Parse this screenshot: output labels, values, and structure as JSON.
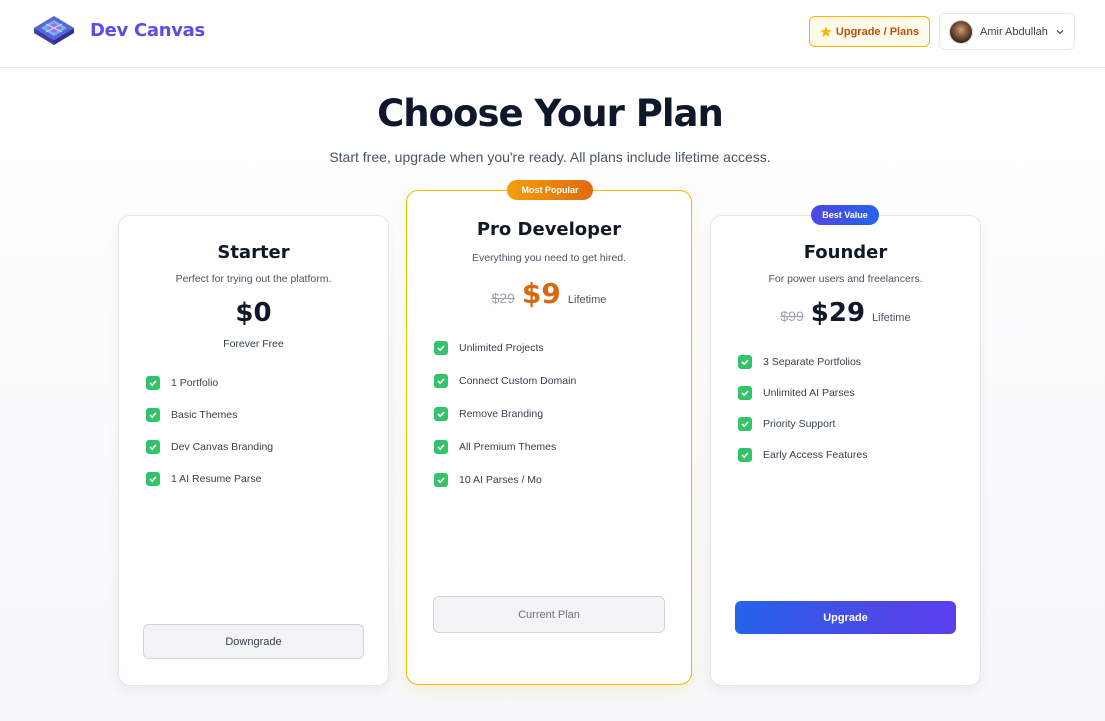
{
  "header": {
    "brand": "Dev Canvas",
    "upgrade_label": "Upgrade / Plans",
    "user_name": "Amir Abdullah"
  },
  "main": {
    "title": "Choose Your Plan",
    "subtitle": "Start free, upgrade when you're ready. All plans include lifetime access."
  },
  "plans": [
    {
      "name": "Starter",
      "description": "Perfect for trying out the platform.",
      "price": "$0",
      "price_note": "Forever Free",
      "features": [
        "1 Portfolio",
        "Basic Themes",
        "Dev Canvas Branding",
        "1 AI Resume Parse"
      ],
      "button_label": "Downgrade"
    },
    {
      "badge": "Most Popular",
      "name": "Pro Developer",
      "description": "Everything you need to get hired.",
      "old_price": "$29",
      "price": "$9",
      "price_suffix": "Lifetime",
      "features": [
        "Unlimited Projects",
        "Connect Custom Domain",
        "Remove Branding",
        "All Premium Themes",
        "10 AI Parses / Mo"
      ],
      "button_label": "Current Plan"
    },
    {
      "badge": "Best Value",
      "name": "Founder",
      "description": "For power users and freelancers.",
      "old_price": "$99",
      "price": "$29",
      "price_suffix": "Lifetime",
      "features": [
        "3 Separate Portfolios",
        "Unlimited AI Parses",
        "Priority Support",
        "Early Access Features"
      ],
      "button_label": "Upgrade"
    }
  ],
  "colors": {
    "brand": "#5b4de8",
    "accent_orange": "#d9670f",
    "popular_border": "#f5b700",
    "check_green": "#34c36b",
    "upgrade_blue": "#2563eb"
  },
  "icons": [
    "logo-icon",
    "star-icon",
    "avatar",
    "chevron-down-icon",
    "check-icon"
  ]
}
